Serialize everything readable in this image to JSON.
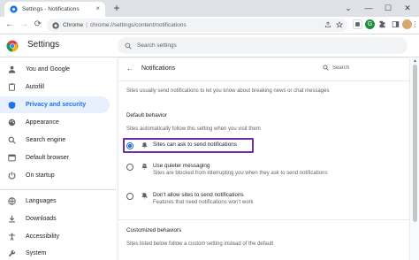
{
  "browser": {
    "tab_title": "Settings - Notifications",
    "tab_close": "×",
    "new_tab": "+",
    "window_controls": {
      "dropdown": "⌄",
      "minimize": "—",
      "maximize": "☐",
      "close": "✕"
    },
    "nav": {
      "back": "←",
      "forward": "→",
      "reload": "⟳"
    },
    "omnibox": {
      "prefix": "Chrome",
      "separator": "|",
      "url": "chrome://settings/content/notifications"
    },
    "extension_letter": "G"
  },
  "settings": {
    "title": "Settings",
    "search_placeholder": "Search settings"
  },
  "sidebar": {
    "items": [
      {
        "label": "You and Google",
        "icon": "person-icon",
        "active": false
      },
      {
        "label": "Autofill",
        "icon": "clipboard-icon",
        "active": false
      },
      {
        "label": "Privacy and security",
        "icon": "shield-icon",
        "active": true
      },
      {
        "label": "Appearance",
        "icon": "palette-icon",
        "active": false
      },
      {
        "label": "Search engine",
        "icon": "search-icon",
        "active": false
      },
      {
        "label": "Default browser",
        "icon": "browser-icon",
        "active": false
      },
      {
        "label": "On startup",
        "icon": "power-icon",
        "active": false
      },
      {
        "label": "Languages",
        "icon": "globe-icon",
        "active": false
      },
      {
        "label": "Downloads",
        "icon": "download-icon",
        "active": false
      },
      {
        "label": "Accessibility",
        "icon": "accessibility-icon",
        "active": false
      },
      {
        "label": "System",
        "icon": "wrench-icon",
        "active": false
      }
    ]
  },
  "main": {
    "title": "Notifications",
    "back": "←",
    "search_placeholder": "Search",
    "intro": "Sites usually send notifications to let you know about breaking news or chat messages",
    "default_behavior": {
      "heading": "Default behavior",
      "description": "Sites automatically follow this setting when you visit them",
      "options": [
        {
          "label": "Sites can ask to send notifications",
          "sub": "",
          "selected": true,
          "icon": "bell-icon"
        },
        {
          "label": "Use quieter messaging",
          "sub": "Sites are blocked from interrupting you when they ask to send notifications",
          "selected": false,
          "icon": "bell-quiet-icon"
        },
        {
          "label": "Don't allow sites to send notifications",
          "sub": "Features that need notifications won't work",
          "selected": false,
          "icon": "bell-off-icon"
        }
      ]
    },
    "customized": {
      "heading": "Customized behaviors",
      "description": "Sites listed below follow a custom setting instead of the default"
    }
  },
  "colors": {
    "accent": "#1a73e8",
    "highlight_box": "#6f2da8",
    "sidebar_active_bg": "#e8f0fe"
  }
}
